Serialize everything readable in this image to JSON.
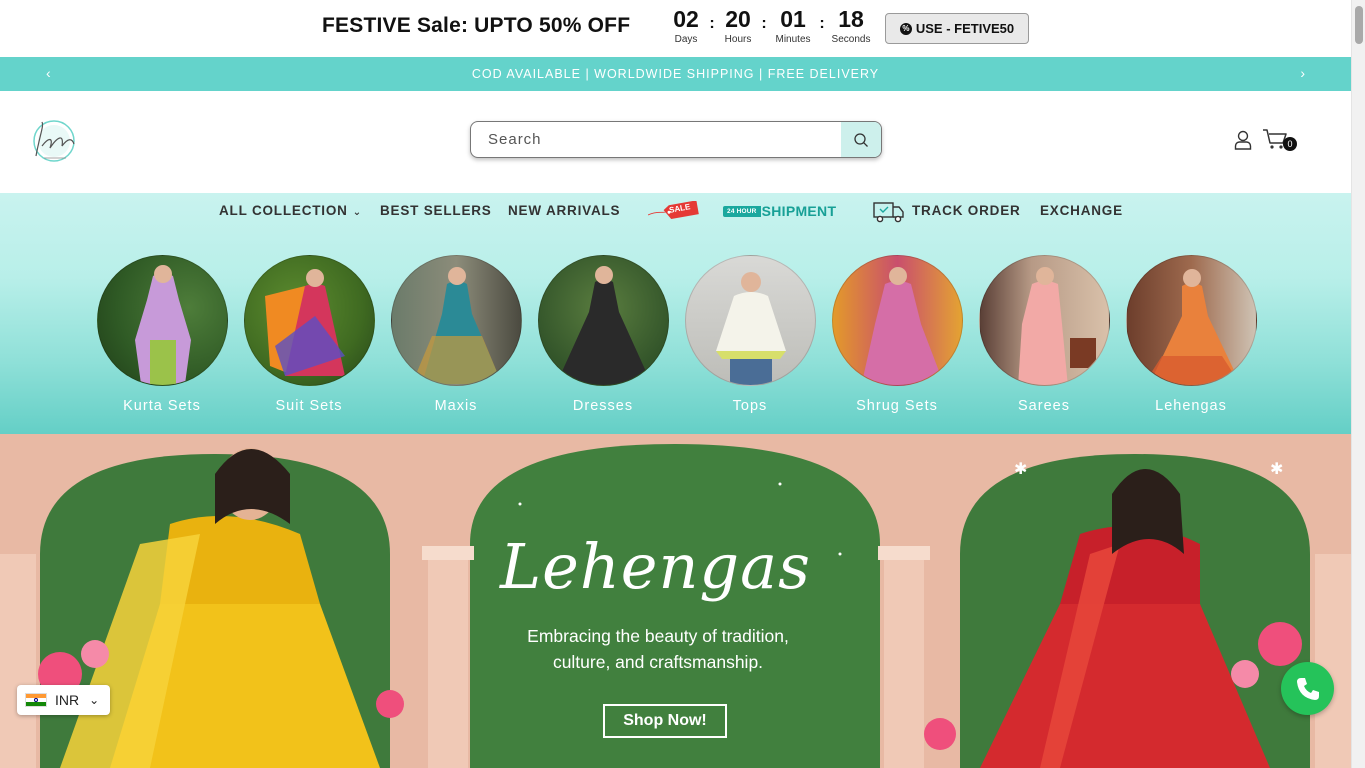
{
  "promo": {
    "title": "FESTIVE Sale: UPTO 50% OFF",
    "countdown": [
      {
        "value": "02",
        "label": "Days"
      },
      {
        "value": "20",
        "label": "Hours"
      },
      {
        "value": "01",
        "label": "Minutes"
      },
      {
        "value": "18",
        "label": "Seconds"
      }
    ],
    "coupon": "USE - FETIVE50"
  },
  "announcement": {
    "text": "COD AVAILABLE | WORLDWIDE SHIPPING | FREE DELIVERY"
  },
  "header": {
    "search_placeholder": "Search",
    "cart_count": "0",
    "icons": [
      "search-icon",
      "account-icon",
      "cart-icon"
    ]
  },
  "nav": {
    "all_collection": "ALL COLLECTION",
    "best_sellers": "BEST SELLERS",
    "new_arrivals": "NEW ARRIVALS",
    "sale": "SALE",
    "shipment_badge": "24 HOUR",
    "shipment": "SHIPMENT",
    "track_order": "TRACK ORDER",
    "exchange": "EXCHANGE"
  },
  "categories": [
    {
      "label": "Kurta Sets"
    },
    {
      "label": "Suit Sets"
    },
    {
      "label": "Maxis"
    },
    {
      "label": "Dresses"
    },
    {
      "label": "Tops"
    },
    {
      "label": "Shrug Sets"
    },
    {
      "label": "Sarees"
    },
    {
      "label": "Lehengas"
    }
  ],
  "hero": {
    "title": "Lehengas",
    "subtitle_line1": "Embracing the beauty of tradition,",
    "subtitle_line2": "culture, and craftsmanship.",
    "cta": "Shop Now!"
  },
  "currency": {
    "code": "INR"
  },
  "colors": {
    "accent": "#64d3cb",
    "whatsapp": "#25c35a",
    "hero_bg": "#e8b9a4",
    "hero_green": "#3f7a3c"
  }
}
